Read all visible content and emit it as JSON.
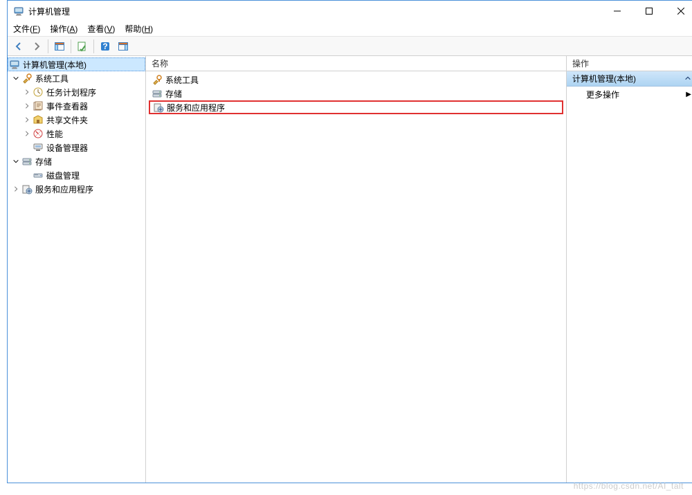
{
  "window": {
    "title": "计算机管理"
  },
  "menubar": [
    {
      "label": "文件",
      "accel": "F"
    },
    {
      "label": "操作",
      "accel": "A"
    },
    {
      "label": "查看",
      "accel": "V"
    },
    {
      "label": "帮助",
      "accel": "H"
    }
  ],
  "tree": {
    "root": {
      "label": "计算机管理(本地)"
    },
    "system_tools": {
      "label": "系统工具",
      "children": [
        {
          "label": "任务计划程序"
        },
        {
          "label": "事件查看器"
        },
        {
          "label": "共享文件夹"
        },
        {
          "label": "性能"
        },
        {
          "label": "设备管理器"
        }
      ]
    },
    "storage": {
      "label": "存储",
      "children": [
        {
          "label": "磁盘管理"
        }
      ]
    },
    "services_apps": {
      "label": "服务和应用程序"
    }
  },
  "list": {
    "header": "名称",
    "rows": [
      {
        "label": "系统工具",
        "icon": "tools"
      },
      {
        "label": "存储",
        "icon": "storage"
      },
      {
        "label": "服务和应用程序",
        "icon": "services",
        "highlight": true
      }
    ]
  },
  "actions": {
    "header": "操作",
    "section": "计算机管理(本地)",
    "more": "更多操作"
  },
  "watermark": "https://blog.csdn.net/AI_talt"
}
